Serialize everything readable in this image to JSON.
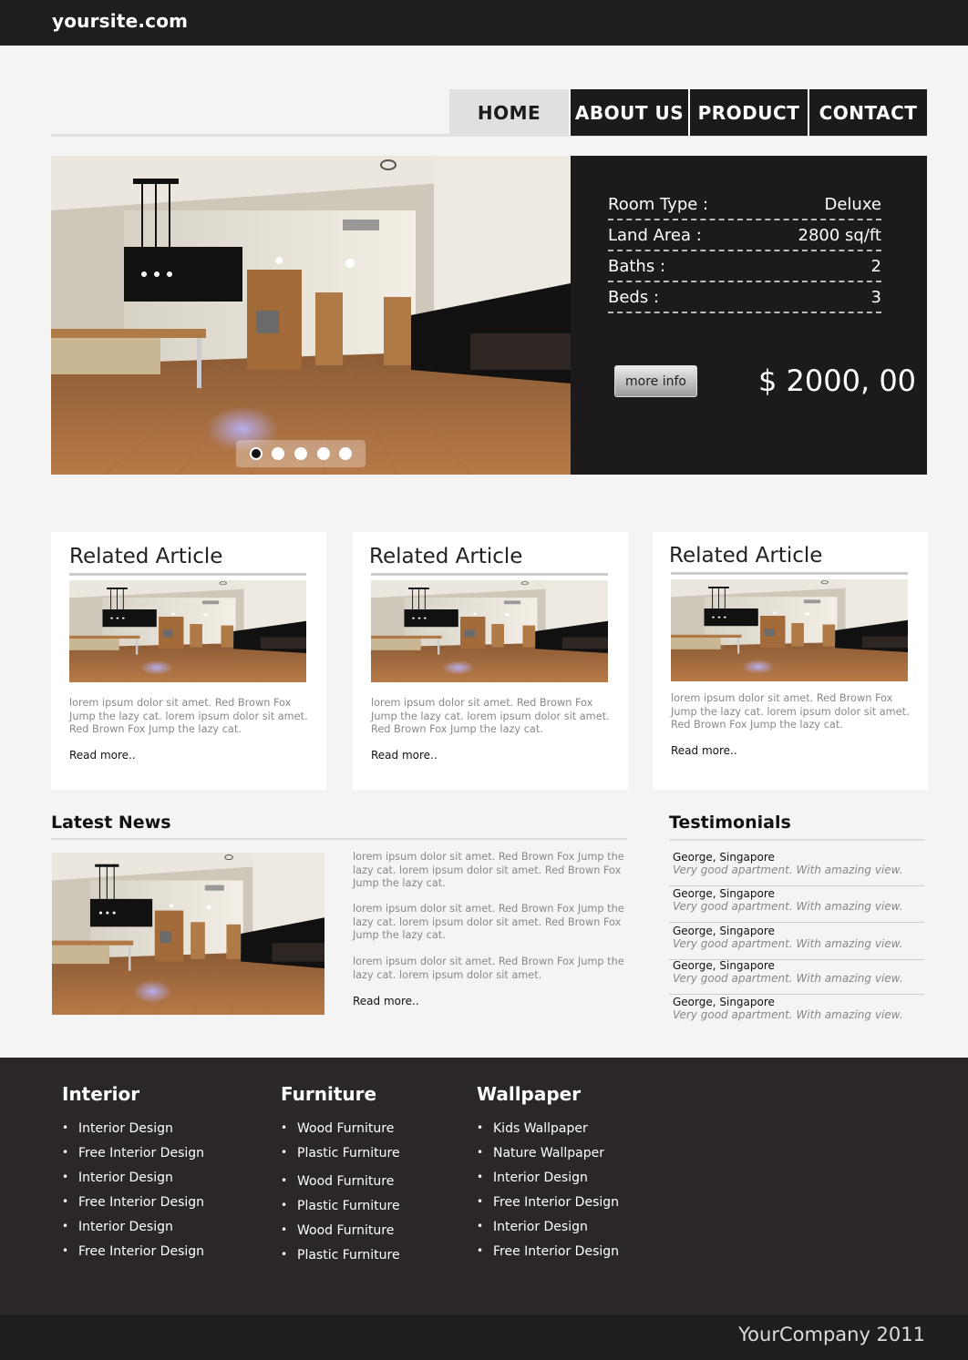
{
  "header": {
    "site_name": "yoursite.com"
  },
  "nav": {
    "items": [
      {
        "label": "HOME"
      },
      {
        "label": "ABOUT US"
      },
      {
        "label": "PRODUCT"
      },
      {
        "label": "CONTACT"
      }
    ],
    "active": "HOME"
  },
  "hero": {
    "specs": [
      {
        "label": "Room Type :",
        "value": "Deluxe"
      },
      {
        "label": "Land Area :",
        "value": "2800 sq/ft"
      },
      {
        "label": "Baths :",
        "value": "2"
      },
      {
        "label": "Beds :",
        "value": "3"
      }
    ],
    "more_info_label": "more info",
    "price": "$ 2000, 00",
    "slides_count": 5,
    "active_slide": 1
  },
  "related": [
    {
      "title": "Related Article",
      "text": "lorem ipsum dolor sit amet. Red Brown Fox Jump the lazy cat. lorem ipsum dolor sit amet. Red Brown Fox Jump the lazy cat.",
      "more": "Read more.."
    },
    {
      "title": "Related Article",
      "text": "lorem ipsum dolor sit amet. Red Brown Fox Jump the lazy cat. lorem ipsum dolor sit amet. Red Brown Fox Jump the lazy cat.",
      "more": "Read more.."
    },
    {
      "title": "Related Article",
      "text": "lorem ipsum dolor sit amet. Red Brown Fox Jump the lazy cat. lorem ipsum dolor sit amet. Red Brown Fox Jump the lazy cat.",
      "more": "Read more.."
    }
  ],
  "latest_news": {
    "title": "Latest News",
    "paragraphs": [
      "lorem ipsum dolor sit amet. Red Brown Fox Jump the lazy cat. lorem ipsum dolor sit amet. Red Brown Fox Jump the lazy cat.",
      "lorem ipsum dolor sit amet. Red Brown Fox Jump the lazy cat. lorem ipsum dolor sit amet. Red Brown Fox Jump the lazy cat.",
      "lorem ipsum dolor sit amet. Red Brown Fox Jump the lazy cat. lorem ipsum dolor sit amet."
    ],
    "more": "Read more.."
  },
  "testimonials": {
    "title": "Testimonials",
    "items": [
      {
        "name": "George, Singapore",
        "quote": "Very good apartment. With amazing view."
      },
      {
        "name": "George, Singapore",
        "quote": "Very good apartment. With amazing view."
      },
      {
        "name": "George, Singapore",
        "quote": "Very good apartment. With amazing view."
      },
      {
        "name": "George, Singapore",
        "quote": "Very good apartment. With amazing view."
      },
      {
        "name": "George, Singapore",
        "quote": "Very good apartment. With amazing view."
      }
    ]
  },
  "footer": {
    "columns": [
      {
        "title": "Interior",
        "links": [
          "Interior Design",
          "Free Interior Design",
          "Interior Design",
          "Free Interior Design",
          "Interior Design",
          "Free Interior Design"
        ]
      },
      {
        "title": "Furniture",
        "links": [
          "Wood Furniture",
          "Plastic Furniture",
          "Wood Furniture",
          "Plastic Furniture",
          "Wood Furniture",
          "Plastic Furniture"
        ]
      },
      {
        "title": "Wallpaper",
        "links": [
          "Kids Wallpaper",
          "Nature Wallpaper",
          "Interior Design",
          "Free Interior Design",
          "Interior Design",
          "Free Interior Design"
        ]
      }
    ],
    "copyright": "YourCompany 2011"
  },
  "colors": {
    "dark": "#1c1a1b",
    "footer": "#2b2728",
    "page_bg": "#f4f4f4",
    "nav_active": "#e0e0e0"
  }
}
